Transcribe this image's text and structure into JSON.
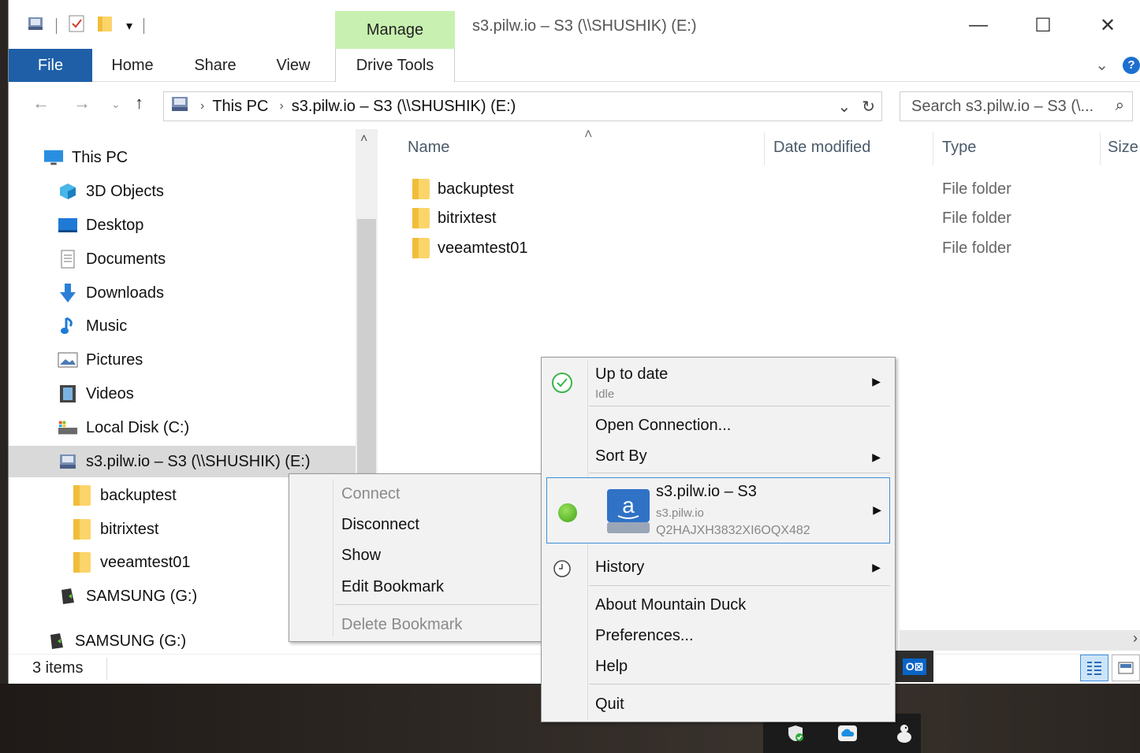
{
  "window": {
    "title": "s3.pilw.io – S3 (\\\\SHUSHIK) (E:)",
    "manage_tab": "Manage",
    "minimize": "—",
    "maximize": "☐",
    "close": "✕"
  },
  "ribbon": {
    "tabs": [
      "File",
      "Home",
      "Share",
      "View",
      "Drive Tools"
    ],
    "collapse": "⌄",
    "help": "?"
  },
  "address": {
    "path": [
      "This PC",
      "s3.pilw.io – S3 (\\\\SHUSHIK) (E:)"
    ],
    "search_placeholder": "Search s3.pilw.io – S3 (\\..."
  },
  "nav": {
    "items": [
      {
        "label": "This PC",
        "icon": "monitor-icon"
      },
      {
        "label": "3D Objects",
        "icon": "cube-icon"
      },
      {
        "label": "Desktop",
        "icon": "desktop-icon"
      },
      {
        "label": "Documents",
        "icon": "document-icon"
      },
      {
        "label": "Downloads",
        "icon": "download-arrow-icon"
      },
      {
        "label": "Music",
        "icon": "music-note-icon"
      },
      {
        "label": "Pictures",
        "icon": "pictures-icon"
      },
      {
        "label": "Videos",
        "icon": "film-icon"
      },
      {
        "label": "Local Disk (C:)",
        "icon": "hard-disk-icon"
      },
      {
        "label": "s3.pilw.io – S3 (\\\\SHUSHIK) (E:)",
        "icon": "network-drive-icon"
      },
      {
        "label": "backuptest",
        "icon": "folder-icon"
      },
      {
        "label": "bitrixtest",
        "icon": "folder-icon"
      },
      {
        "label": "veeamtest01",
        "icon": "folder-icon"
      },
      {
        "label": "SAMSUNG (G:)",
        "icon": "usb-drive-icon"
      },
      {
        "label": "SAMSUNG (G:)",
        "icon": "usb-drive-icon"
      }
    ]
  },
  "columns": [
    "Name",
    "Date modified",
    "Type",
    "Size"
  ],
  "files": [
    {
      "name": "backuptest",
      "type": "File folder"
    },
    {
      "name": "bitrixtest",
      "type": "File folder"
    },
    {
      "name": "veeamtest01",
      "type": "File folder"
    }
  ],
  "status": {
    "count": "3 items"
  },
  "bookmark_menu": {
    "items": [
      "Connect",
      "Disconnect",
      "Show",
      "Edit Bookmark",
      "Delete Bookmark"
    ]
  },
  "app_menu": {
    "status_title": "Up to date",
    "status_sub": "Idle",
    "open_connection": "Open Connection...",
    "sort_by": "Sort By",
    "bookmark_title": "s3.pilw.io – S3",
    "bookmark_host": "s3.pilw.io",
    "bookmark_key": "Q2HAJXH3832XI6OQX482",
    "history": "History",
    "about": "About Mountain Duck",
    "preferences": "Preferences...",
    "help": "Help",
    "quit": "Quit"
  },
  "colors": {
    "file_tab": "#1e5fa8",
    "manage_tab": "#c8f0b0",
    "selection": "#d9d9d9",
    "folder": "#fbd56a",
    "status_ok": "#3ea41c",
    "highlight_border": "#3c8fd8"
  }
}
